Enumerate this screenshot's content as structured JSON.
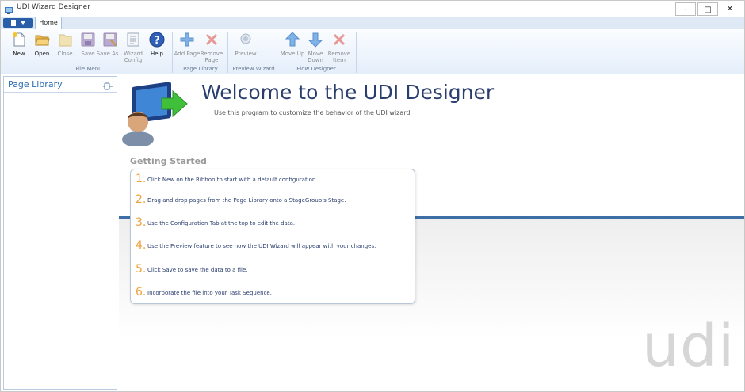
{
  "window": {
    "title": "UDI Wizard Designer",
    "minimize_glyph": "–",
    "maximize_glyph": "□",
    "close_glyph": "✕"
  },
  "ribbon": {
    "tabs": [
      {
        "label": "Home"
      }
    ],
    "groups": [
      {
        "label": "File Menu",
        "buttons": [
          {
            "label": "New",
            "icon": "new-document-icon"
          },
          {
            "label": "Open",
            "icon": "open-folder-icon"
          },
          {
            "label": "Close",
            "icon": "close-folder-icon"
          },
          {
            "label": "Save",
            "icon": "save-icon"
          },
          {
            "label": "Save As...",
            "icon": "save-as-icon"
          },
          {
            "label": "Wizard Config",
            "icon": "wizard-config-icon"
          },
          {
            "label": "Help",
            "icon": "help-icon"
          }
        ]
      },
      {
        "label": "Page Library",
        "buttons": [
          {
            "label": "Add Page",
            "icon": "add-icon"
          },
          {
            "label": "Remove Page",
            "icon": "remove-icon"
          }
        ]
      },
      {
        "label": "Preview Wizard",
        "buttons": [
          {
            "label": "Preview",
            "icon": "preview-icon"
          }
        ]
      },
      {
        "label": "Flow Designer",
        "buttons": [
          {
            "label": "Move Up",
            "icon": "arrow-up-icon"
          },
          {
            "label": "Move Down",
            "icon": "arrow-down-icon"
          },
          {
            "label": "Remove Item",
            "icon": "remove-item-icon"
          }
        ]
      }
    ]
  },
  "library": {
    "title": "Page Library"
  },
  "main": {
    "heading": "Welcome to the UDI Designer",
    "subtitle": "Use this program to customize the behavior of the UDI wizard",
    "getting_started": "Getting Started",
    "steps": [
      {
        "num": "1.",
        "text": "Click New on the Ribbon to start with a default configuration"
      },
      {
        "num": "2.",
        "text": "Drag and drop pages from the Page Library onto a StageGroup's Stage."
      },
      {
        "num": "3.",
        "text": "Use the Configuration Tab at the top to edit the data."
      },
      {
        "num": "4.",
        "text": "Use the Preview feature to see how the UDI Wizard will appear with your changes."
      },
      {
        "num": "5.",
        "text": "Click Save to save the data to a file."
      },
      {
        "num": "6.",
        "text": "Incorporate the file into your Task Sequence."
      }
    ],
    "watermark": "udi"
  },
  "colors": {
    "accent": "#2a6db0",
    "heading": "#2a3e6e",
    "step_number": "#f0a13a",
    "divider": "#3d6fa6"
  }
}
